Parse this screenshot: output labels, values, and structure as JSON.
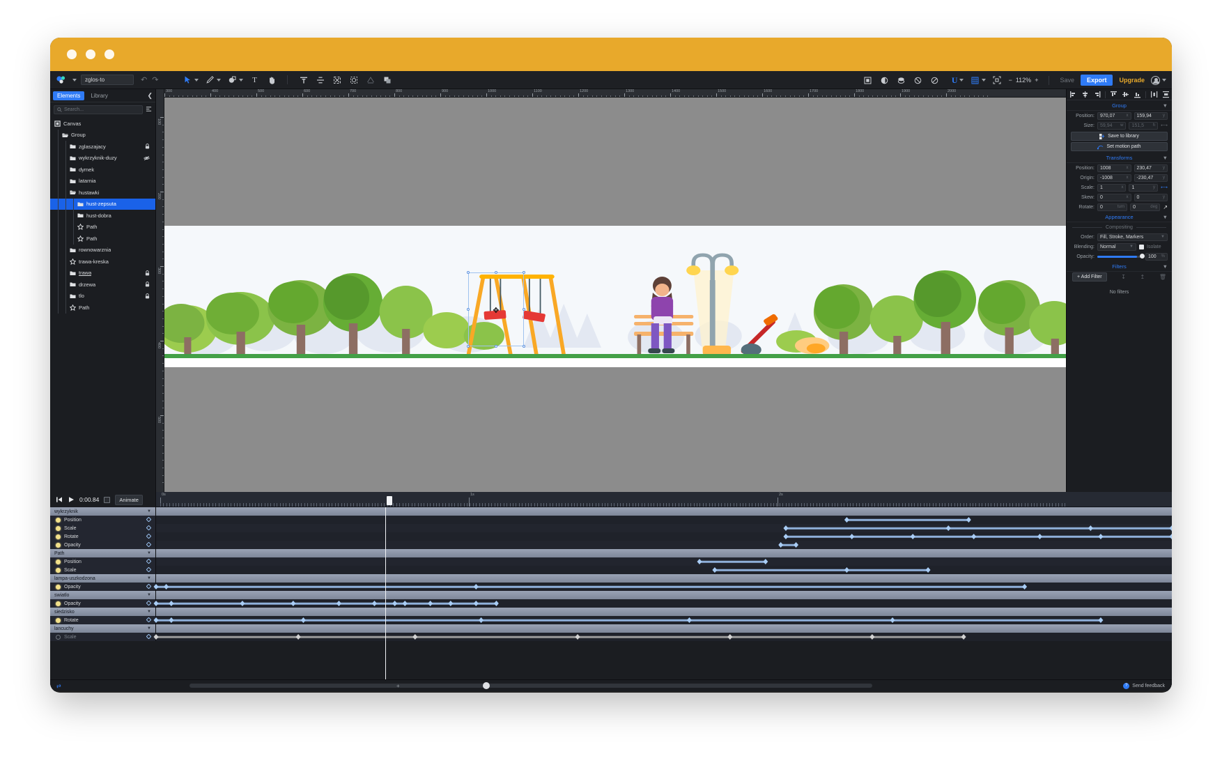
{
  "app": {
    "document_name": "zglos-to",
    "zoom_level": "112%",
    "save_label": "Save",
    "export_label": "Export",
    "upgrade_label": "Upgrade",
    "logo_icon": "vectr-logo-icon",
    "undo_icon": "undo-icon",
    "redo_icon": "redo-icon",
    "avatar_icon": "user-avatar-icon"
  },
  "toolbar": {
    "tools": [
      {
        "name": "select-tool-icon",
        "glyph": "➤",
        "active": true,
        "has_caret": true
      },
      {
        "name": "pen-tool-icon",
        "glyph": "✎",
        "active": false,
        "has_caret": true
      },
      {
        "name": "shape-tool-icon",
        "glyph": "●",
        "active": false,
        "has_caret": true
      },
      {
        "name": "text-tool-icon",
        "glyph": "T",
        "active": false,
        "has_caret": false
      },
      {
        "name": "hand-tool-icon",
        "glyph": "✋",
        "active": false,
        "has_caret": false
      }
    ],
    "boolean_tools": [
      {
        "name": "align-tool-icon"
      },
      {
        "name": "distribute-tool-icon"
      },
      {
        "name": "group-tool-icon"
      },
      {
        "name": "ungroup-tool-icon"
      },
      {
        "name": "mask-tool-icon"
      },
      {
        "name": "duplicate-tool-icon"
      }
    ],
    "path_tools": [
      {
        "name": "union-icon"
      },
      {
        "name": "subtract-icon"
      },
      {
        "name": "intersect-icon"
      },
      {
        "name": "exclude-icon"
      },
      {
        "name": "divide-icon"
      }
    ],
    "units_label": "U",
    "grid_icon": "grid-icon",
    "fit_icon": "fit-to-screen-icon",
    "zoom_out_label": "−",
    "zoom_in_label": "+"
  },
  "left_panel": {
    "tabs": [
      {
        "label": "Elements",
        "active": true
      },
      {
        "label": "Library",
        "active": false
      }
    ],
    "collapse_icon": "chevron-left-icon",
    "search": {
      "placeholder": "Search...",
      "value": "",
      "icon": "search-icon"
    },
    "filter_icon": "list-options-icon",
    "tree": [
      {
        "label": "Canvas",
        "depth": 0,
        "icon": "canvas-icon",
        "selected": false,
        "badge": "",
        "underline": false
      },
      {
        "label": "Group",
        "depth": 1,
        "icon": "folder-open",
        "selected": false,
        "badge": "",
        "underline": false
      },
      {
        "label": "zglaszajacy",
        "depth": 2,
        "icon": "folder",
        "selected": false,
        "badge": "lock",
        "underline": false
      },
      {
        "label": "wykrzyknik-duzy",
        "depth": 2,
        "icon": "folder",
        "selected": false,
        "badge": "hidden",
        "underline": false
      },
      {
        "label": "dymek",
        "depth": 2,
        "icon": "folder",
        "selected": false,
        "badge": "",
        "underline": false
      },
      {
        "label": "latarnia",
        "depth": 2,
        "icon": "folder",
        "selected": false,
        "badge": "",
        "underline": false
      },
      {
        "label": "hustawki",
        "depth": 2,
        "icon": "folder-open",
        "selected": false,
        "badge": "",
        "underline": false
      },
      {
        "label": "hust-zepsuta",
        "depth": 3,
        "icon": "folder",
        "selected": true,
        "badge": "",
        "underline": false
      },
      {
        "label": "hust-dobra",
        "depth": 3,
        "icon": "folder",
        "selected": false,
        "badge": "",
        "underline": false
      },
      {
        "label": "Path",
        "depth": 3,
        "icon": "path",
        "selected": false,
        "badge": "",
        "underline": false
      },
      {
        "label": "Path",
        "depth": 3,
        "icon": "path",
        "selected": false,
        "badge": "",
        "underline": false
      },
      {
        "label": "rownowarznia",
        "depth": 2,
        "icon": "folder",
        "selected": false,
        "badge": "",
        "underline": false
      },
      {
        "label": "trawa-kreska",
        "depth": 2,
        "icon": "path",
        "selected": false,
        "badge": "",
        "underline": false
      },
      {
        "label": "trawa",
        "depth": 2,
        "icon": "folder",
        "selected": false,
        "badge": "lock",
        "underline": true
      },
      {
        "label": "drzewa",
        "depth": 2,
        "icon": "folder",
        "selected": false,
        "badge": "lock",
        "underline": false
      },
      {
        "label": "tlo",
        "depth": 2,
        "icon": "folder",
        "selected": false,
        "badge": "lock",
        "underline": false
      },
      {
        "label": "Path",
        "depth": 2,
        "icon": "path",
        "selected": false,
        "badge": "",
        "underline": false
      }
    ]
  },
  "right_panel": {
    "section_group": {
      "title": "Group",
      "position_label": "Position:",
      "position_x": "970,07",
      "position_y": "159,94",
      "size_label": "Size:",
      "size_w": "59,94",
      "size_h": "151,5",
      "save_to_library": "Save to library",
      "set_motion_path": "Set motion path",
      "save_icon": "save-to-library-icon",
      "motion_icon": "motion-path-icon",
      "link_icon": "link-ratio-icon"
    },
    "section_transforms": {
      "title": "Transforms",
      "position_label": "Position:",
      "position_x": "1008",
      "position_y": "230,47",
      "origin_label": "Origin:",
      "origin_x": "-1008",
      "origin_y": "-230,47",
      "scale_label": "Scale:",
      "scale_x": "1",
      "scale_y": "1",
      "skew_label": "Skew:",
      "skew_x": "0",
      "skew_y": "0",
      "rotate_label": "Rotate:",
      "rotate_turn": "0",
      "rotate_turn_unit": "turn",
      "rotate_deg": "0",
      "rotate_deg_unit": "deg",
      "link_icon": "link-scale-icon",
      "rotate_icon": "rotate-handle-icon"
    },
    "section_appearance": {
      "title": "Appearance",
      "compositing_label": "Compositing",
      "order_label": "Order:",
      "order_value": "Fill, Stroke, Markers",
      "blending_label": "Blending:",
      "blending_value": "Normal",
      "isolate_label": "Isolate",
      "opacity_label": "Opacity:",
      "opacity_value": "100",
      "opacity_unit": "%"
    },
    "section_filters": {
      "title": "Filters",
      "add_filter_label": "Add Filter",
      "empty_label": "No filters",
      "import_icon": "import-filter-icon",
      "export_icon": "export-filter-icon",
      "delete_icon": "delete-filter-icon"
    },
    "align_icons": [
      "align-left-icon",
      "align-center-h-icon",
      "align-right-icon",
      "align-top-icon",
      "align-middle-v-icon",
      "align-bottom-icon",
      "distribute-h-icon",
      "distribute-v-icon"
    ]
  },
  "timeline": {
    "go_start_icon": "skip-to-start-icon",
    "play_icon": "play-icon",
    "current_time": "0:00.84",
    "loop_icon": "loop-icon",
    "animate_label": "Animate",
    "ruler_labels": [
      "0s",
      "1s",
      "2s"
    ],
    "playhead_position_pct": 25.2,
    "rows": [
      {
        "type": "group",
        "label": "wykrzyknik",
        "keys": [],
        "lines": []
      },
      {
        "type": "prop",
        "label": "Position",
        "bulb": "on",
        "keys": [
          68.0,
          80.0
        ],
        "lines": [
          [
            68.0,
            80.0
          ]
        ]
      },
      {
        "type": "prop",
        "label": "Scale",
        "bulb": "on",
        "keys": [
          62.0,
          78.0,
          92.0,
          100.0
        ],
        "lines": [
          [
            62.0,
            100.0
          ]
        ]
      },
      {
        "type": "prop",
        "label": "Rotate",
        "bulb": "on",
        "keys": [
          62.0,
          68.5,
          74.5,
          80.5,
          87.0,
          93.0,
          100.0
        ],
        "lines": [
          [
            62.0,
            100.0
          ]
        ]
      },
      {
        "type": "prop",
        "label": "Opacity",
        "bulb": "on",
        "keys": [
          61.5,
          63.0
        ],
        "lines": [
          [
            61.5,
            63.0
          ]
        ]
      },
      {
        "type": "group",
        "label": "Path",
        "keys": [],
        "lines": []
      },
      {
        "type": "prop",
        "label": "Position",
        "bulb": "on",
        "keys": [
          53.5,
          60.0
        ],
        "lines": [
          [
            53.5,
            60.0
          ]
        ]
      },
      {
        "type": "prop",
        "label": "Scale",
        "bulb": "on",
        "keys": [
          55.0,
          68.0,
          76.0
        ],
        "lines": [
          [
            55.0,
            76.0
          ]
        ]
      },
      {
        "type": "group",
        "label": "lampa-uszkodzona",
        "keys": [],
        "lines": []
      },
      {
        "type": "prop",
        "label": "Opacity",
        "bulb": "on",
        "keys": [
          0.0,
          1.0,
          31.5,
          85.5
        ],
        "lines": [
          [
            0.0,
            85.5
          ]
        ]
      },
      {
        "type": "group",
        "label": "swiatlo",
        "keys": [],
        "lines": []
      },
      {
        "type": "prop",
        "label": "Opacity",
        "bulb": "on",
        "keys": [
          0.0,
          1.5,
          8.5,
          13.5,
          18.0,
          21.5,
          23.5,
          24.5,
          27.0,
          29.0,
          31.5,
          33.5
        ],
        "lines": [
          [
            0.0,
            33.5
          ]
        ]
      },
      {
        "type": "group",
        "label": "siedzisko",
        "keys": [],
        "lines": []
      },
      {
        "type": "prop",
        "label": "Rotate",
        "bulb": "on",
        "keys": [
          0.0,
          1.5,
          14.5,
          32.0,
          52.5,
          72.5,
          93.0
        ],
        "lines": [
          [
            0.0,
            93.0
          ]
        ]
      },
      {
        "type": "group",
        "label": "lancuchy",
        "keys": [],
        "lines": []
      },
      {
        "type": "prop",
        "label": "Scale",
        "bulb": "off",
        "grey": true,
        "keys": [
          0.0,
          14.0,
          25.5,
          41.5,
          56.5,
          70.5,
          79.5
        ],
        "lines": [
          [
            0.0,
            79.5
          ]
        ]
      }
    ],
    "feedback_label": "Send feedback",
    "feedback_icon": "feedback-icon",
    "zoom_out_label": "−",
    "zoom_in_label": "+",
    "keyframe_icon": "keyframe-diamond-icon"
  },
  "canvas": {
    "ruler_h_labels": [
      "300",
      "400",
      "500",
      "600",
      "700",
      "800",
      "900",
      "1000",
      "1100",
      "1200",
      "1300",
      "1400",
      "1500",
      "1600",
      "1700",
      "1800",
      "1900",
      "2000"
    ],
    "ruler_v_labels": [
      "100",
      "200",
      "300",
      "400",
      "500"
    ],
    "selection": {
      "name": "hust-zepsuta-selection"
    }
  },
  "colors": {
    "accent": "#2f7bf6",
    "titlebar": "#e8a92b",
    "upgrade": "#e8a92b",
    "panel_bg": "#1b1d21",
    "canvas_bg": "#8c8c8c",
    "artboard_bg": "#f5f8fb",
    "selection_row": "#1a62e8",
    "keyframe": "#a9cdf5"
  }
}
